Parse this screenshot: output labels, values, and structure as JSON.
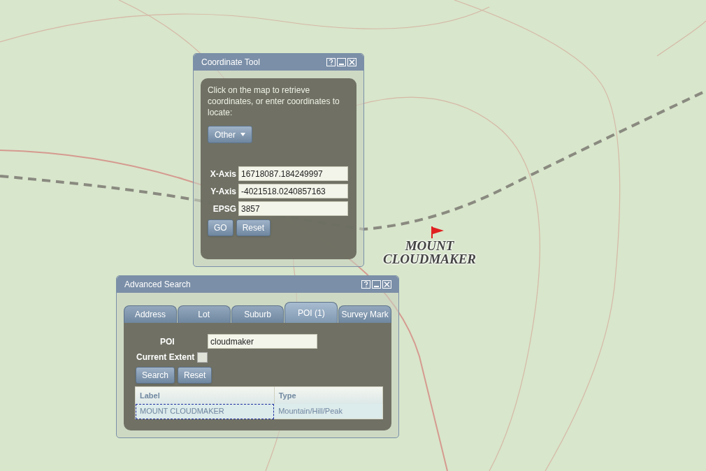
{
  "map": {
    "place_label": [
      "MOUNT",
      "CLOUDMAKER"
    ]
  },
  "coordinate_tool": {
    "title": "Coordinate Tool",
    "instructions": "Click on the map to retrieve coordinates, or enter coordinates to locate:",
    "dropdown": "Other",
    "fields": [
      {
        "label": "X-Axis",
        "value": "16718087.184249997"
      },
      {
        "label": "Y-Axis",
        "value": "-4021518.0240857163"
      },
      {
        "label": "EPSG",
        "value": "3857"
      }
    ],
    "buttons": [
      "GO",
      "Reset"
    ]
  },
  "advanced_search": {
    "title": "Advanced Search",
    "tabs": [
      {
        "label": "Address",
        "selected": false
      },
      {
        "label": "Lot",
        "selected": false
      },
      {
        "label": "Suburb",
        "selected": false
      },
      {
        "label": "POI (1)",
        "selected": true
      },
      {
        "label": "Survey Mark",
        "selected": false
      }
    ],
    "poi_field": {
      "label": "POI",
      "value": "cloudmaker"
    },
    "current_extent": {
      "label": "Current Extent",
      "checked": false
    },
    "buttons": [
      "Search",
      "Reset"
    ],
    "table": {
      "columns": [
        "Label",
        "Type"
      ],
      "rows": [
        {
          "cells": [
            "MOUNT CLOUDMAKER",
            "Mountain/Hill/Peak"
          ],
          "selected": true
        }
      ]
    }
  }
}
